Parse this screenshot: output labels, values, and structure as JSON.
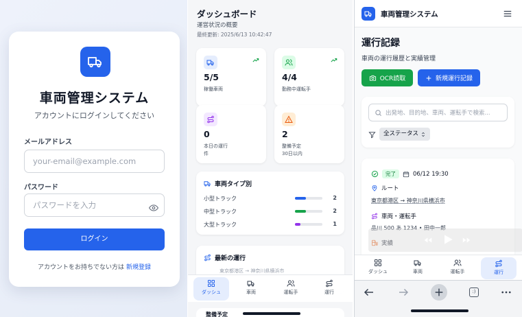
{
  "login": {
    "title": "車両管理システム",
    "subtitle": "アカウントにログインしてください",
    "email_label": "メールアドレス",
    "email_placeholder": "your-email@example.com",
    "password_label": "パスワード",
    "password_placeholder": "パスワードを入力",
    "login_button": "ログイン",
    "signup_prompt": "アカウントをお持ちでない方は",
    "signup_link": "新規登録",
    "accent_color": "#2563eb"
  },
  "dashboard": {
    "title": "ダッシュボード",
    "subtitle": "運営状況の概要",
    "last_updated": "最終更新: 2025/6/13 10:42:47",
    "stats": [
      {
        "icon": "truck-icon",
        "value": "5/5",
        "label": "稼働車両",
        "trend": true
      },
      {
        "icon": "users-icon",
        "value": "4/4",
        "label": "勤務中運転手",
        "trend": true
      },
      {
        "icon": "route-icon",
        "value": "0",
        "label": "本日の運行",
        "sublabel": "件"
      },
      {
        "icon": "warning-icon",
        "value": "2",
        "label": "整備予定",
        "sublabel": "30日以内"
      }
    ],
    "vehicle_types": {
      "heading": "車両タイプ別",
      "rows": [
        {
          "name": "小型トラック",
          "count": "2",
          "fraction": 0.4,
          "color": "#2563eb"
        },
        {
          "name": "中型トラック",
          "count": "2",
          "fraction": 0.4,
          "color": "#16a34a"
        },
        {
          "name": "大型トラック",
          "count": "1",
          "fraction": 0.2,
          "color": "#9333ea"
        }
      ]
    },
    "recent_trips": {
      "heading": "最新の運行",
      "preview": "東京都港区 → 神奈川県横浜市"
    },
    "next_heading": "整備予定",
    "nav": [
      {
        "label": "ダッシュ",
        "icon": "grid-icon",
        "active": true
      },
      {
        "label": "車両",
        "icon": "truck-icon",
        "active": false
      },
      {
        "label": "運転手",
        "icon": "users-icon",
        "active": false
      },
      {
        "label": "運行",
        "icon": "route-icon",
        "active": false
      }
    ]
  },
  "trips": {
    "app_title": "車両管理システム",
    "title": "運行記録",
    "subtitle": "車両の運行履歴と実績管理",
    "ocr_button": "OCR読取",
    "new_button": "新規運行記録",
    "search_placeholder": "出発地、目的地、車両、運転手で検索...",
    "status_filter": "全ステータス",
    "record": {
      "status": "完了",
      "datetime": "06/12 19:30",
      "route_label": "ルート",
      "route": "東京都港区 → 神奈川県横浜市",
      "vehicle_driver_label": "車両・運転手",
      "vehicle_driver": "品川 500 あ 1234 • 田中一郎",
      "result_label": "実績"
    },
    "nav": [
      {
        "label": "ダッシュ",
        "icon": "grid-icon",
        "active": false
      },
      {
        "label": "車両",
        "icon": "truck-icon",
        "active": false
      },
      {
        "label": "運転手",
        "icon": "users-icon",
        "active": false
      },
      {
        "label": "運行",
        "icon": "route-icon",
        "active": true
      }
    ],
    "browser_tab_count": ":)"
  }
}
